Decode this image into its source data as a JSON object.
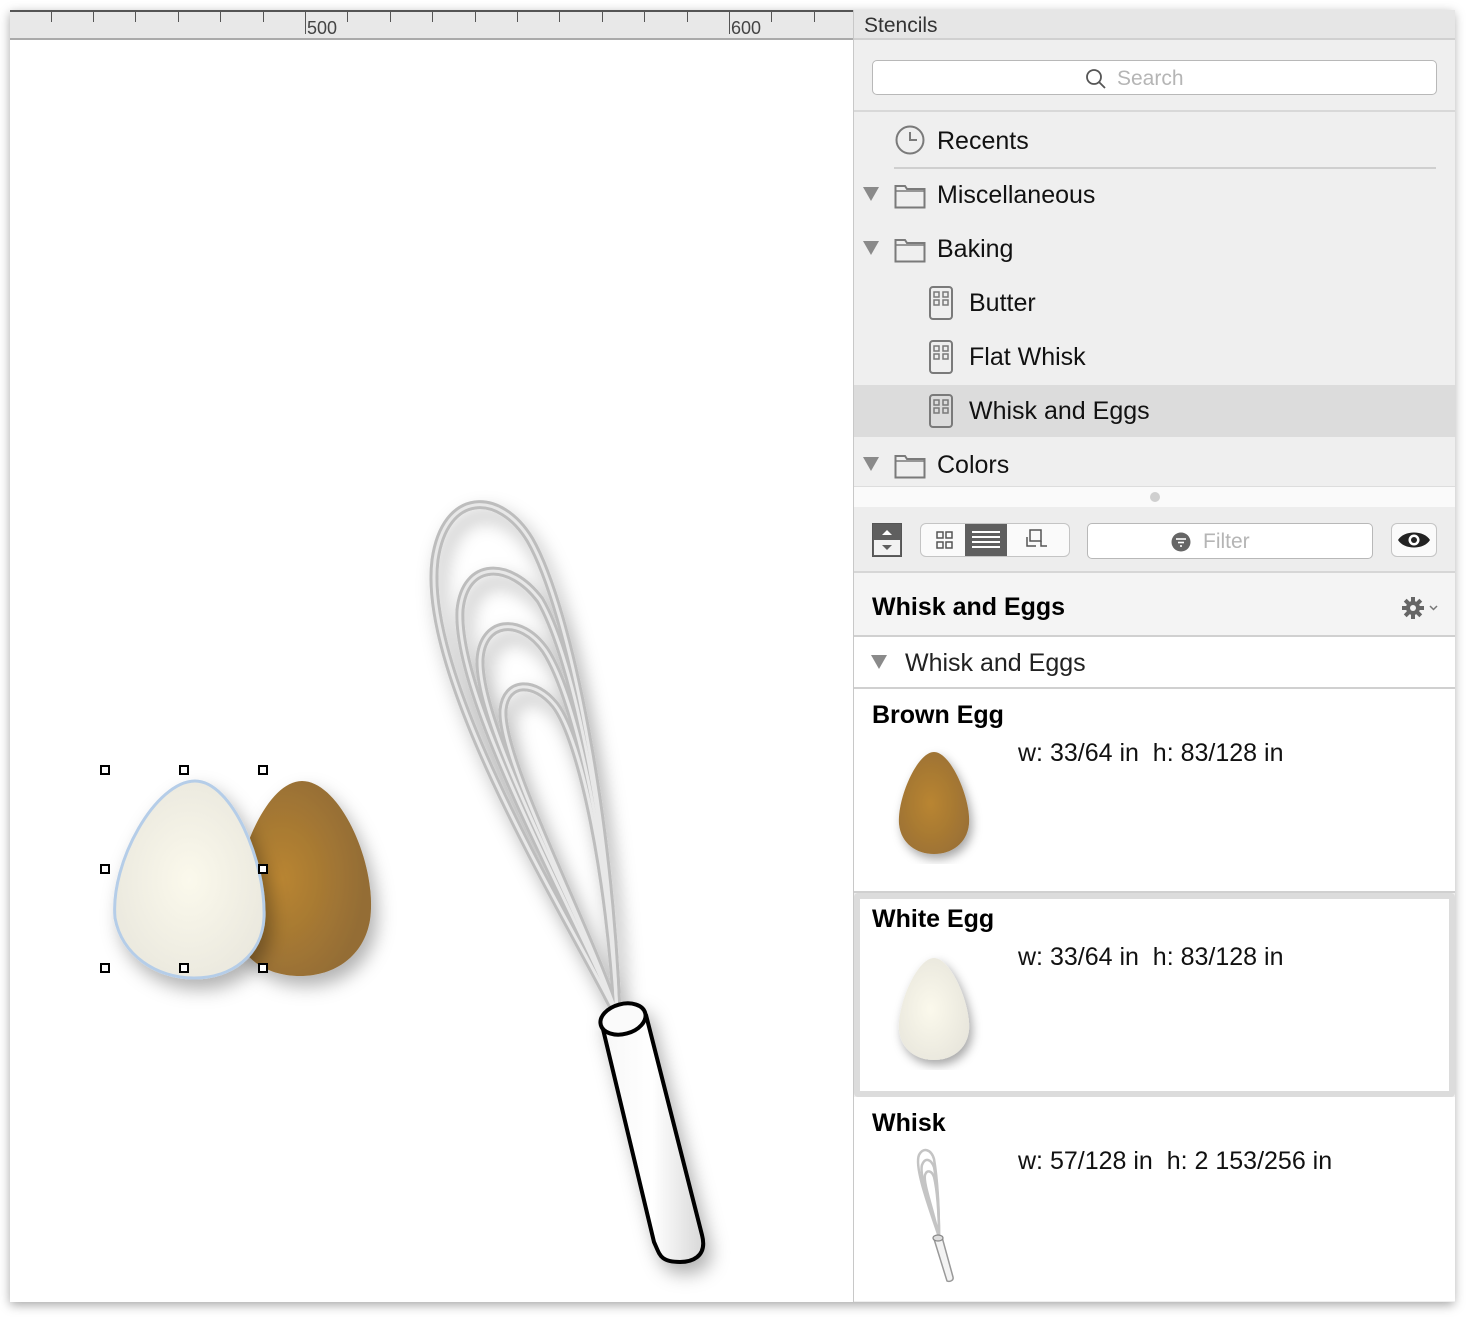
{
  "ruler": {
    "labels": [
      "500",
      "600"
    ]
  },
  "canvas": {
    "objects": [
      {
        "name": "White Egg",
        "selected": true,
        "fill": "#f1efe4"
      },
      {
        "name": "Brown Egg",
        "selected": false,
        "fill": "#a87a35"
      },
      {
        "name": "Whisk",
        "selected": false
      }
    ]
  },
  "sidebar": {
    "title": "Stencils",
    "search_placeholder": "Search",
    "tree": [
      {
        "label": "Recents",
        "icon": "clock-icon",
        "level": 0,
        "expandable": false
      },
      {
        "label": "Miscellaneous",
        "icon": "folder-icon",
        "level": 0,
        "expandable": true,
        "expanded": true
      },
      {
        "label": "Baking",
        "icon": "folder-icon",
        "level": 0,
        "expandable": true,
        "expanded": true
      },
      {
        "label": "Butter",
        "icon": "stencil-icon",
        "level": 1
      },
      {
        "label": "Flat Whisk",
        "icon": "stencil-icon",
        "level": 1
      },
      {
        "label": "Whisk and Eggs",
        "icon": "stencil-icon",
        "level": 1,
        "selected": true
      },
      {
        "label": "Colors",
        "icon": "folder-icon",
        "level": 0,
        "expandable": true,
        "expanded": true
      }
    ],
    "toolbar": {
      "view_modes": [
        "grid-view",
        "list-view",
        "outline-view"
      ],
      "active_view": "list-view",
      "filter_placeholder": "Filter"
    },
    "stencil": {
      "title": "Whisk and Eggs",
      "group_label": "Whisk and Eggs",
      "items": [
        {
          "name": "Brown Egg",
          "dims": "w: 33/64 in  h: 83/128 in",
          "selected": false
        },
        {
          "name": "White Egg",
          "dims": "w: 33/64 in  h: 83/128 in",
          "selected": true
        },
        {
          "name": "Whisk",
          "dims": "w: 57/128 in  h: 2 153/256 in",
          "selected": false
        }
      ]
    }
  }
}
